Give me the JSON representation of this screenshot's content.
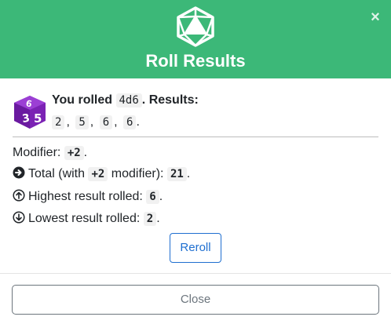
{
  "modal": {
    "title": "Roll Results",
    "close_x": "×",
    "icons": {
      "header": "d20-icon",
      "die": "d6-die-icon",
      "total": "arrow-circle-right-icon",
      "highest": "arrow-circle-up-icon",
      "lowest": "arrow-circle-down-icon"
    },
    "colors": {
      "header_bg": "#3cb878",
      "die": "#7b22b4",
      "primary": "#1f6fd0"
    }
  },
  "roll": {
    "prefix": "You rolled",
    "dice": "4d6",
    "suffix": ". Results:",
    "results": [
      "2",
      "5",
      "6",
      "6"
    ],
    "results_end": "."
  },
  "modifier": {
    "label": "Modifier:",
    "value": "+2",
    "end": "."
  },
  "total": {
    "label_a": "Total (with",
    "modifier": "+2",
    "label_b": "modifier):",
    "value": "21",
    "end": "."
  },
  "highest": {
    "label": "Highest result rolled:",
    "value": "6",
    "end": "."
  },
  "lowest": {
    "label": "Lowest result rolled:",
    "value": "2",
    "end": "."
  },
  "buttons": {
    "reroll": "Reroll",
    "close": "Close"
  }
}
